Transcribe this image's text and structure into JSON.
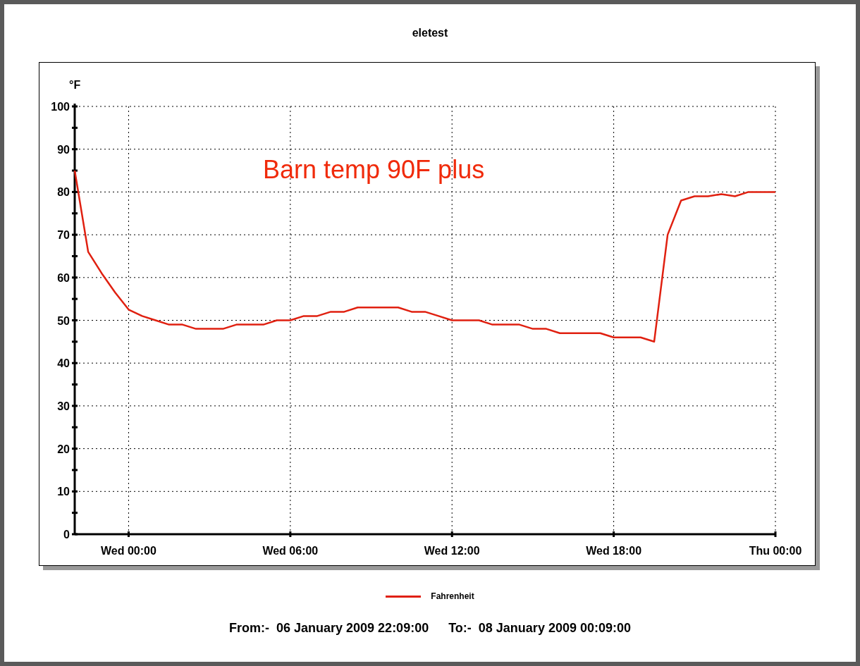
{
  "page": {
    "title": "eletest"
  },
  "chart_data": {
    "type": "line",
    "grid": true,
    "ylabel": "°F",
    "ylim": [
      0,
      100
    ],
    "yticks": [
      0,
      10,
      20,
      30,
      40,
      50,
      60,
      70,
      80,
      90,
      100
    ],
    "categories": [
      null,
      null,
      null,
      null,
      "Wed 00:00",
      null,
      null,
      null,
      null,
      null,
      null,
      null,
      null,
      null,
      null,
      null,
      "Wed 06:00",
      null,
      null,
      null,
      null,
      null,
      null,
      null,
      null,
      null,
      null,
      null,
      "Wed 12:00",
      null,
      null,
      null,
      null,
      null,
      null,
      null,
      null,
      null,
      null,
      null,
      "Wed 18:00",
      null,
      null,
      null,
      null,
      null,
      null,
      null,
      null,
      null,
      null,
      null,
      "Thu 00:00"
    ],
    "series": [
      {
        "name": "Fahrenheit",
        "color": "#e02010",
        "values": [
          85,
          66,
          61,
          56.5,
          52.5,
          51,
          50,
          49,
          49,
          48,
          48,
          48,
          49,
          49,
          49,
          50,
          50,
          51,
          51,
          52,
          52,
          53,
          53,
          53,
          53,
          52,
          52,
          51,
          50,
          50,
          50,
          49,
          49,
          49,
          48,
          48,
          47,
          47,
          47,
          47,
          46,
          46,
          46,
          45,
          70,
          78,
          79,
          79,
          79.5,
          79,
          80,
          80,
          80
        ]
      }
    ],
    "annotations": [
      "Barn temp 90F plus"
    ]
  },
  "footer": {
    "from_label": "From:-",
    "from": "06 January 2009 22:09:00",
    "to_label": "To:-",
    "to": "08 January 2009 00:09:00"
  }
}
